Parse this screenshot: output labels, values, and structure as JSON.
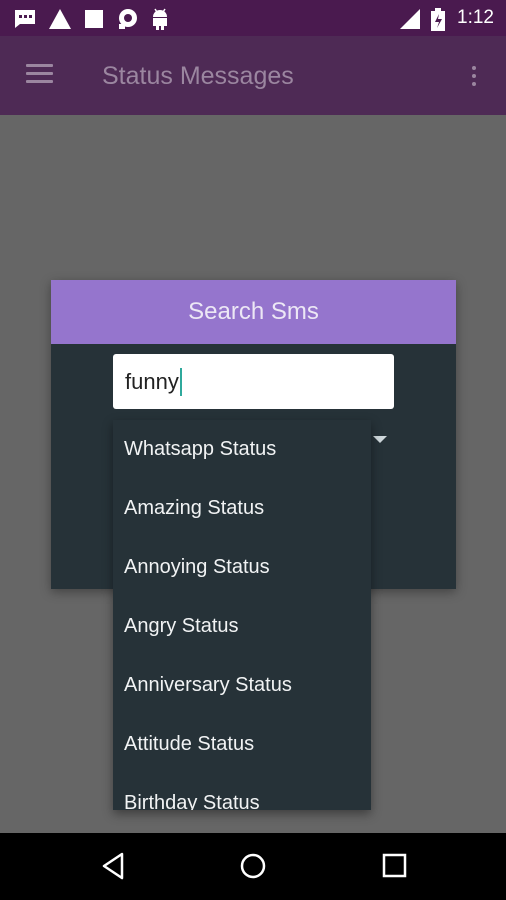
{
  "statusbar": {
    "time": "1:12",
    "icons": [
      "message-icon",
      "warning-icon",
      "square-icon",
      "location-icon",
      "android-icon",
      "signal-icon",
      "battery-icon"
    ]
  },
  "appbar": {
    "title": "Status Messages",
    "icons": [
      "menu-icon",
      "overflow-menu-icon"
    ]
  },
  "dialog": {
    "title": "Search Sms",
    "search": {
      "value": "funny"
    },
    "dropdown": {
      "items": [
        "Whatsapp Status",
        "Amazing Status",
        "Annoying Status",
        "Angry Status",
        "Anniversary Status",
        "Attitude Status",
        "Birthday Status"
      ]
    }
  },
  "navbar": {
    "icons": [
      "back-icon",
      "home-icon",
      "recents-icon"
    ]
  },
  "colors": {
    "status_bar": "#4a1a4f",
    "app_bar_dimmed": "#4e2a55",
    "dialog_header": "#9575cd",
    "dialog_body": "#263238",
    "overlay": "#666666",
    "cursor": "#2fa99c"
  }
}
